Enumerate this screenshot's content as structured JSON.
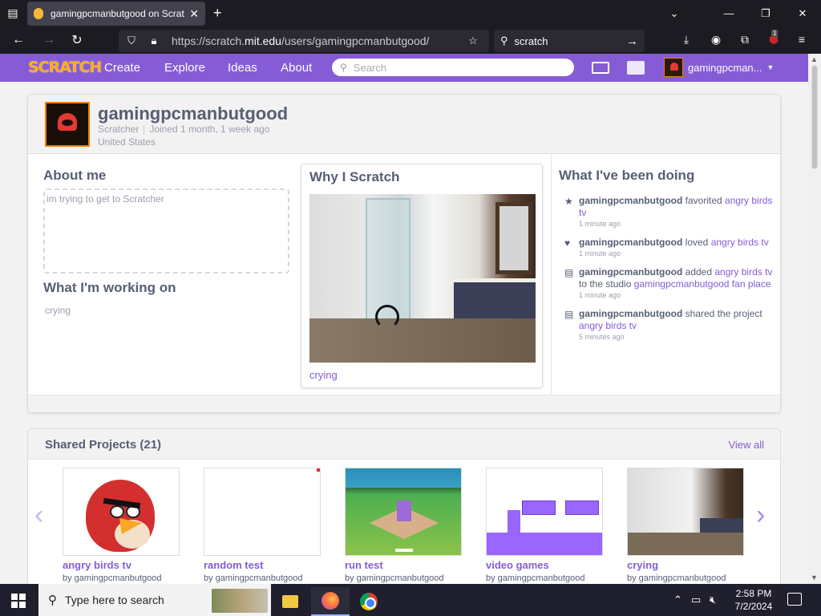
{
  "browser": {
    "tab_title": "gamingpcmanbutgood on Scratch",
    "url_prefix": "https://scratch.",
    "url_domain": "mit.edu",
    "url_path": "/users/gamingpcmanbutgood/",
    "search_text": "scratch",
    "ublock_count": "1"
  },
  "scratch_nav": {
    "logo": "SCRATCH",
    "links": [
      "Create",
      "Explore",
      "Ideas",
      "About"
    ],
    "search_placeholder": "Search",
    "username": "gamingpcman..."
  },
  "profile": {
    "username": "gamingpcmanbutgood",
    "role": "Scratcher",
    "joined": "Joined 1 month, 1 week ago",
    "location": "United States",
    "about_title": "About me",
    "about_text": "im trying to get to Scratcher",
    "working_title": "What I'm working on",
    "working_text": "crying",
    "why_title": "Why I Scratch",
    "featured_caption": "crying",
    "activity_title": "What I've been doing"
  },
  "activity": [
    {
      "icon": "star-icon",
      "user": "gamingpcmanbutgood",
      "verb": " favorited ",
      "link": "angry birds tv",
      "extra": "",
      "extra_link": "",
      "time": "1 minute ago"
    },
    {
      "icon": "heart-icon",
      "user": "gamingpcmanbutgood",
      "verb": " loved ",
      "link": "angry birds tv",
      "extra": "",
      "extra_link": "",
      "time": "1 minute ago"
    },
    {
      "icon": "studio-icon",
      "user": "gamingpcmanbutgood",
      "verb": " added ",
      "link": "angry birds tv",
      "extra": " to the studio ",
      "extra_link": "gamingpcmanbutgood fan place",
      "time": "1 minute ago"
    },
    {
      "icon": "share-icon",
      "user": "gamingpcmanbutgood",
      "verb": " shared the project ",
      "link": "angry birds tv",
      "extra": "",
      "extra_link": "",
      "time": "5 minutes ago"
    }
  ],
  "shared": {
    "title": "Shared Projects (21)",
    "view_all": "View all",
    "projects": [
      {
        "title": "angry birds tv",
        "by": "by gamingpcmanbutgood"
      },
      {
        "title": "random test",
        "by": "by gamingpcmanbutgood"
      },
      {
        "title": "run test",
        "by": "by gamingpcmanbutgood"
      },
      {
        "title": "video games",
        "by": "by gamingpcmanbutgood"
      },
      {
        "title": "crying",
        "by": "by gamingpcmanbutgood"
      }
    ]
  },
  "taskbar": {
    "search_placeholder": "Type here to search",
    "time": "2:58 PM",
    "date": "7/2/2024"
  },
  "colors": {
    "scratch_purple": "#855cd6",
    "browser_dark": "#1c1b22",
    "text_gray": "#575e75"
  }
}
